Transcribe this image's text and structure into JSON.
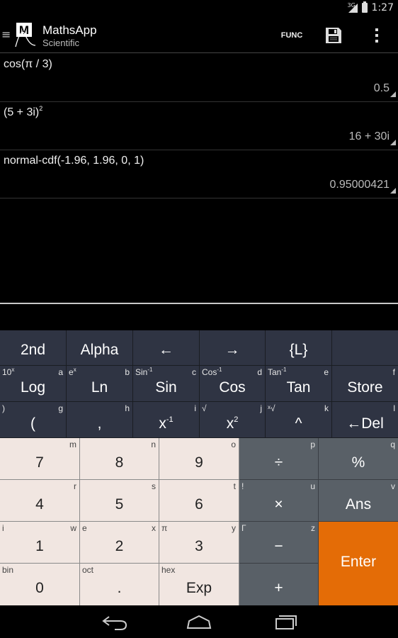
{
  "status": {
    "network": "3G",
    "time": "1:27"
  },
  "app": {
    "logo": "M",
    "title": "MathsApp",
    "subtitle": "Scientific"
  },
  "actions": {
    "func": "FUNC",
    "save_icon": "save-icon",
    "overflow_icon": "overflow-icon"
  },
  "history": [
    {
      "expr": "cos(π / 3)",
      "result": "0.5"
    },
    {
      "expr": "(5 + 3i)",
      "expr_sup": "2",
      "result": "16 + 30i"
    },
    {
      "expr": "normal-cdf(-1.96, 1.96, 0, 1)",
      "result": "0.95000421"
    }
  ],
  "keys": {
    "r1": [
      {
        "main": "2nd"
      },
      {
        "main": "Alpha"
      },
      {
        "main": "←"
      },
      {
        "main": "→"
      },
      {
        "main": "{L}"
      },
      {
        "main": ""
      }
    ],
    "r2": [
      {
        "main": "Log",
        "tl": "10",
        "tl_sup": "x",
        "tr": "a"
      },
      {
        "main": "Ln",
        "tl": "e",
        "tl_sup": "x",
        "tr": "b"
      },
      {
        "main": "Sin",
        "tl": "Sin",
        "tl_sup": "-1",
        "tr": "c"
      },
      {
        "main": "Cos",
        "tl": "Cos",
        "tl_sup": "-1",
        "tr": "d"
      },
      {
        "main": "Tan",
        "tl": "Tan",
        "tl_sup": "-1",
        "tr": "e"
      },
      {
        "main": "Store",
        "tr": "f"
      }
    ],
    "r3": [
      {
        "main": "(",
        "tl": ")",
        "tr": "g"
      },
      {
        "main": ",",
        "tr": "h"
      },
      {
        "main": "x",
        "main_sup": "-1",
        "tr": "i"
      },
      {
        "main": "x",
        "main_sup": "2",
        "tl": "√",
        "tr": "j"
      },
      {
        "main": "^",
        "tl": "ˣ√",
        "tr": "k"
      },
      {
        "main": "←Del",
        "tr": "l"
      }
    ],
    "r4": [
      {
        "main": "7",
        "tr": "m"
      },
      {
        "main": "8",
        "tr": "n"
      },
      {
        "main": "9",
        "tr": "o"
      },
      {
        "main": "÷",
        "tr": "p"
      },
      {
        "main": "%",
        "tr": "q"
      }
    ],
    "r5": [
      {
        "main": "4",
        "tr": "r"
      },
      {
        "main": "5",
        "tr": "s"
      },
      {
        "main": "6",
        "tr": "t"
      },
      {
        "main": "×",
        "tl": "!",
        "tr": "u"
      },
      {
        "main": "Ans",
        "tr": "v"
      }
    ],
    "r6": [
      {
        "main": "1",
        "tl": "i",
        "tr": "w"
      },
      {
        "main": "2",
        "tl": "e",
        "tr": "x"
      },
      {
        "main": "3",
        "tl": "π",
        "tr": "y"
      },
      {
        "main": "−",
        "tl": "Γ",
        "tr": "z"
      }
    ],
    "r7": [
      {
        "main": "0",
        "tl": "bin"
      },
      {
        "main": ".",
        "tl": "oct"
      },
      {
        "main": "Exp",
        "tl": "hex"
      },
      {
        "main": "+"
      }
    ],
    "enter": {
      "main": "Enter"
    }
  },
  "nav": {
    "back_icon": "back-icon",
    "home_icon": "home-icon",
    "recents_icon": "recents-icon"
  },
  "colors": {
    "dark_key": "#2f3443",
    "light_key": "#f1e6e1",
    "grey_key": "#596067",
    "enter_key": "#e46c06"
  }
}
